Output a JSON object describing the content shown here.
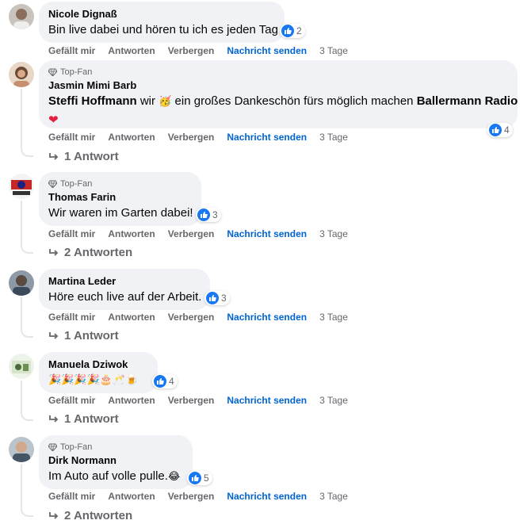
{
  "common": {
    "like": "Gefällt mir",
    "reply": "Antworten",
    "hide": "Verbergen",
    "message": "Nachricht senden",
    "top_fan": "Top-Fan"
  },
  "colors": {
    "like_blue": "#1877f2",
    "link_blue": "#0064d1",
    "bubble": "#f0f2f5",
    "meta": "#65676b"
  },
  "comments": [
    {
      "author": "Nicole Dignaß",
      "text": "Bin live dabei und hören tu ich es jeden Tag",
      "reactions": "2",
      "time": "3 Tage"
    },
    {
      "author": "Jasmin Mimi Barb",
      "top_fan": true,
      "mention1": "Steffi Hoffmann",
      "text_a": "wir",
      "text_b": "ein großes Dankeschön fürs möglich machen",
      "mention2": "Ballermann Radio",
      "emoji_face": "🥳",
      "emoji_heart": "❤",
      "reactions": "4",
      "time": "3 Tage",
      "replies": "1 Antwort"
    },
    {
      "author": "Thomas Farin",
      "top_fan": true,
      "text": "Wir waren im Garten dabei!",
      "reactions": "3",
      "time": "3 Tage",
      "replies": "2 Antworten"
    },
    {
      "author": "Martina Leder",
      "text": "Höre euch live auf der Arbeit.",
      "reactions": "3",
      "time": "3 Tage",
      "replies": "1 Antwort"
    },
    {
      "author": "Manuela Dziwok",
      "emojis": "🎉🎉🎉🎉🎂🥂🍺",
      "reactions": "4",
      "time": "3 Tage",
      "replies": "1 Antwort"
    },
    {
      "author": "Dirk Normann",
      "top_fan": true,
      "text": "Im Auto auf volle pulle.",
      "emoji_end": "😂",
      "reactions": "5",
      "time": "3 Tage",
      "replies": "2 Antworten"
    }
  ]
}
